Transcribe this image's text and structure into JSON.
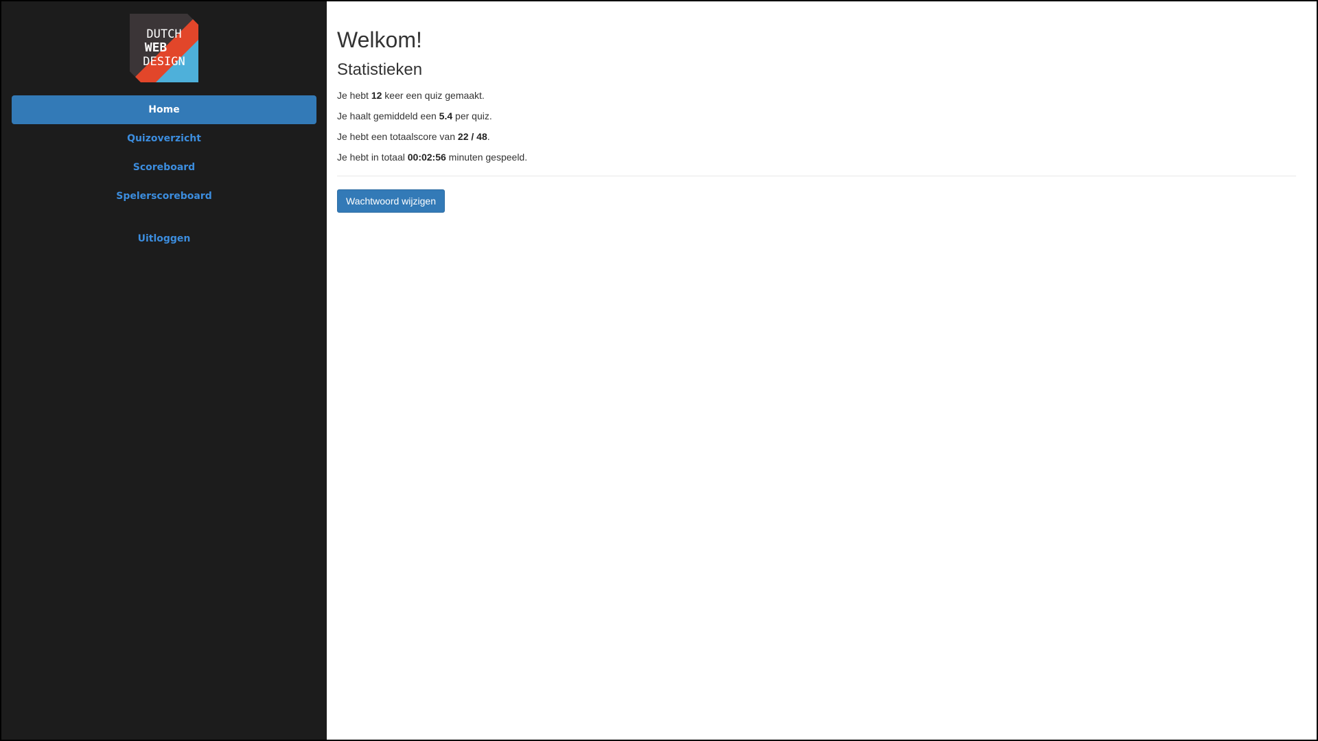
{
  "sidebar": {
    "logo": {
      "lines": [
        "DUTCH",
        "WEB",
        "DESIGN"
      ],
      "colors": {
        "dark": "#3b3537",
        "orange": "#e2462a",
        "blue": "#4eb0da"
      }
    },
    "items": [
      {
        "label": "Home",
        "active": true
      },
      {
        "label": "Quizoverzicht",
        "active": false
      },
      {
        "label": "Scoreboard",
        "active": false
      },
      {
        "label": "Spelerscoreboard",
        "active": false
      }
    ],
    "logout": {
      "label": "Uitloggen"
    }
  },
  "main": {
    "title": "Welkom!",
    "stats_title": "Statistieken",
    "stats": {
      "quiz_count": {
        "prefix": "Je hebt ",
        "value": "12",
        "suffix": " keer een quiz gemaakt."
      },
      "average": {
        "prefix": "Je haalt gemiddeld een ",
        "value": "5.4",
        "suffix": " per quiz."
      },
      "total_score": {
        "prefix": "Je hebt een totaalscore van ",
        "score": "22",
        "separator": " / ",
        "max": "48",
        "suffix": "."
      },
      "play_time": {
        "prefix": "Je hebt in totaal ",
        "value": "00:02:56",
        "suffix": " minuten gespeeld."
      }
    },
    "change_password_label": "Wachtwoord wijzigen"
  },
  "colors": {
    "sidebar_bg": "#1c1c1c",
    "accent": "#337ab7",
    "link": "#3c8dde",
    "text": "#333333"
  }
}
